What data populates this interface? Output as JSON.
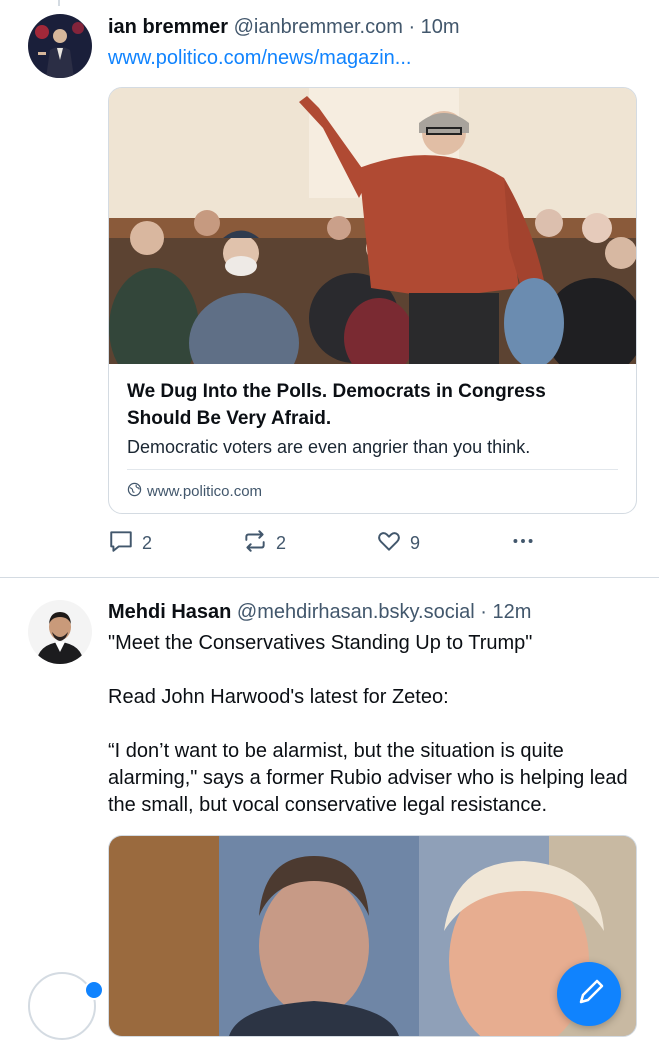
{
  "colors": {
    "accent": "#1083fe",
    "muted": "#42576c",
    "border": "#d4dbe2",
    "text": "#0b0f14"
  },
  "post1": {
    "author_name": "ian bremmer",
    "handle": "@ianbremmer.com",
    "separator": "·",
    "time": "10m",
    "link_text": "www.politico.com/news/magazin...",
    "card": {
      "title": "We Dug Into the Polls. Democrats in Congress Should Be Very Afraid.",
      "description": "Democratic voters are even angrier than you think.",
      "domain": "www.politico.com",
      "domain_icon": "globe-icon"
    },
    "actions": {
      "replies": "2",
      "reposts": "2",
      "likes": "9",
      "more_icon": "more-icon"
    }
  },
  "post2": {
    "author_name": "Mehdi Hasan",
    "handle": "@mehdirhasan.bsky.social",
    "separator": "·",
    "time": "12m",
    "paragraphs": [
      "\"Meet the Conservatives Standing Up to Trump\"",
      "Read John Harwood's latest for Zeteo:",
      "“I don’t want to be alarmist, but the situation is quite alarming,\" says a former Rubio adviser who is helping lead the small, but vocal conservative legal resistance."
    ]
  },
  "compose_icon": "pencil-icon"
}
